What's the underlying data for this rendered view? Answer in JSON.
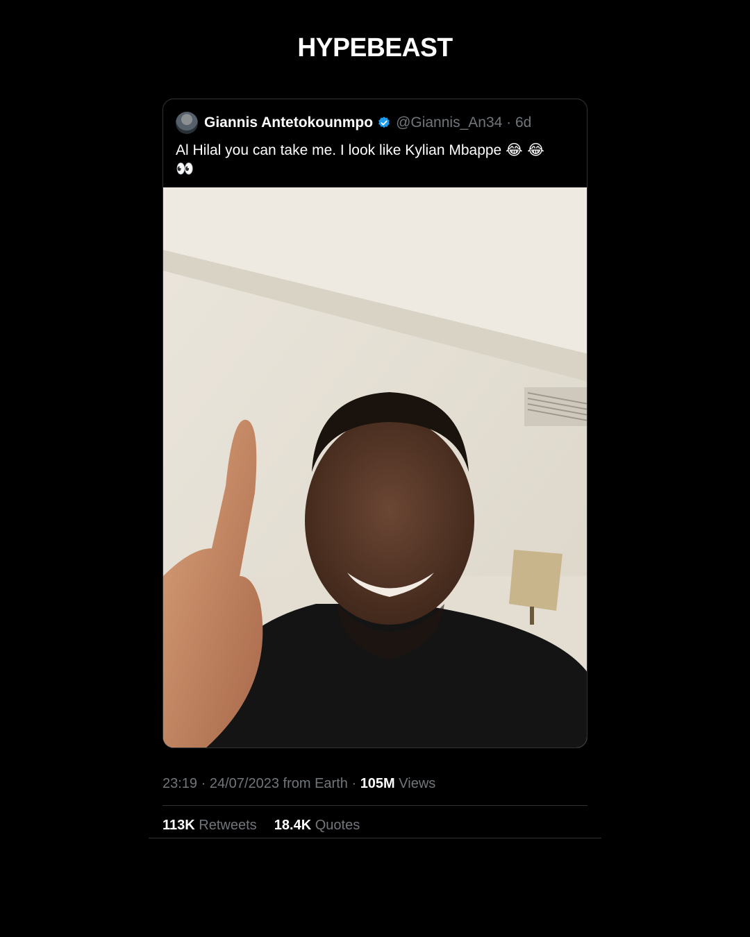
{
  "brand": {
    "title": "HYPEBEAST"
  },
  "tweet": {
    "display_name": "Giannis Antetokounmpo",
    "handle": "@Giannis_An34",
    "separator": "·",
    "age": "6d",
    "text": "Al Hilal you can take me. I look like Kylian Mbappe",
    "emojis_line1": "😂 😂",
    "emojis_line2": "👀",
    "verified_color": "#1d9bf0"
  },
  "meta": {
    "time": "23:19",
    "dot1": "·",
    "date": "24/07/2023",
    "from": "from Earth",
    "dot2": "·",
    "views_count": "105M",
    "views_label": "Views"
  },
  "stats": {
    "retweets_count": "113K",
    "retweets_label": "Retweets",
    "quotes_count": "18.4K",
    "quotes_label": "Quotes"
  }
}
